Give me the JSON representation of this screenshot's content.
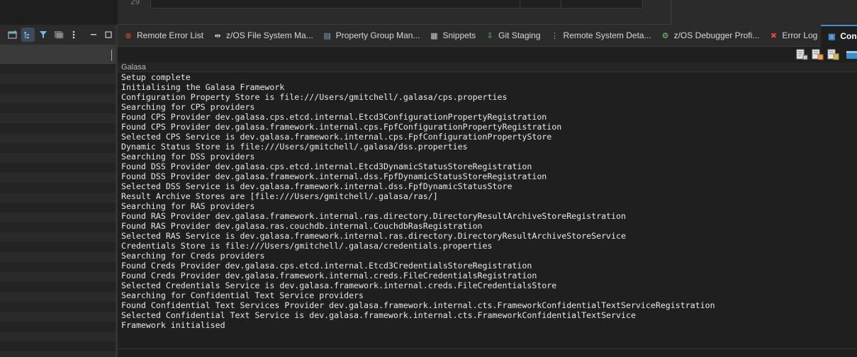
{
  "editor": {
    "line_number": "29"
  },
  "left_panel": {
    "toolbar": [
      {
        "icon": "new-window-icon"
      },
      {
        "icon": "link-editor-icon"
      },
      {
        "icon": "filter-icon"
      },
      {
        "icon": "collapse-icon"
      },
      {
        "icon": "more-options-icon"
      },
      {
        "icon": "minimize-icon"
      },
      {
        "icon": "maximize-icon"
      }
    ]
  },
  "tabs": [
    {
      "label": "Remote Error List",
      "icon": "remote-error-icon"
    },
    {
      "label": "z/OS File System Ma...",
      "icon": "zos-file-icon"
    },
    {
      "label": "Property Group Man...",
      "icon": "property-group-icon"
    },
    {
      "label": "Snippets",
      "icon": "snippets-icon"
    },
    {
      "label": "Git Staging",
      "icon": "git-staging-icon"
    },
    {
      "label": "Remote System Deta...",
      "icon": "remote-system-icon"
    },
    {
      "label": "z/OS Debugger Profi...",
      "icon": "debugger-profile-icon"
    },
    {
      "label": "Error Log",
      "icon": "error-log-icon"
    },
    {
      "label": "Console",
      "icon": "console-icon",
      "active": true,
      "close": "✕"
    }
  ],
  "console": {
    "title": "Galasa",
    "lines": [
      "Setup complete",
      "Initialising the Galasa Framework",
      "Configuration Property Store is file:///Users/gmitchell/.galasa/cps.properties",
      "Searching for CPS providers",
      "Found CPS Provider dev.galasa.cps.etcd.internal.Etcd3ConfigurationPropertyRegistration",
      "Found CPS Provider dev.galasa.framework.internal.cps.FpfConfigurationPropertyRegistration",
      "Selected CPS Service is dev.galasa.framework.internal.cps.FpfConfigurationPropertyStore",
      "Dynamic Status Store is file:///Users/gmitchell/.galasa/dss.properties",
      "Searching for DSS providers",
      "Found DSS Provider dev.galasa.cps.etcd.internal.Etcd3DynamicStatusStoreRegistration",
      "Found DSS Provider dev.galasa.framework.internal.dss.FpfDynamicStatusStoreRegistration",
      "Selected DSS Service is dev.galasa.framework.internal.dss.FpfDynamicStatusStore",
      "Result Archive Stores are [file:///Users/gmitchell/.galasa/ras/]",
      "Searching for RAS providers",
      "Found RAS Provider dev.galasa.framework.internal.ras.directory.DirectoryResultArchiveStoreRegistration",
      "Found RAS Provider dev.galasa.ras.couchdb.internal.CouchdbRasRegistration",
      "Selected RAS Service is dev.galasa.framework.internal.ras.directory.DirectoryResultArchiveStoreService",
      "Credentials Store is file:///Users/gmitchell/.galasa/credentials.properties",
      "Searching for Creds providers",
      "Found Creds Provider dev.galasa.cps.etcd.internal.Etcd3CredentialsStoreRegistration",
      "Found Creds Provider dev.galasa.framework.internal.creds.FileCredentialsRegistration",
      "Selected Credentials Service is dev.galasa.framework.internal.creds.FileCredentialsStore",
      "Searching for Confidential Text Service providers",
      "Found Confidential Text Services Provider dev.galasa.framework.internal.cts.FrameworkConfidentialTextServiceRegistration",
      "Selected Confidential Text Service is dev.galasa.framework.internal.cts.FrameworkConfidentialTextService",
      "Framework initialised"
    ]
  }
}
